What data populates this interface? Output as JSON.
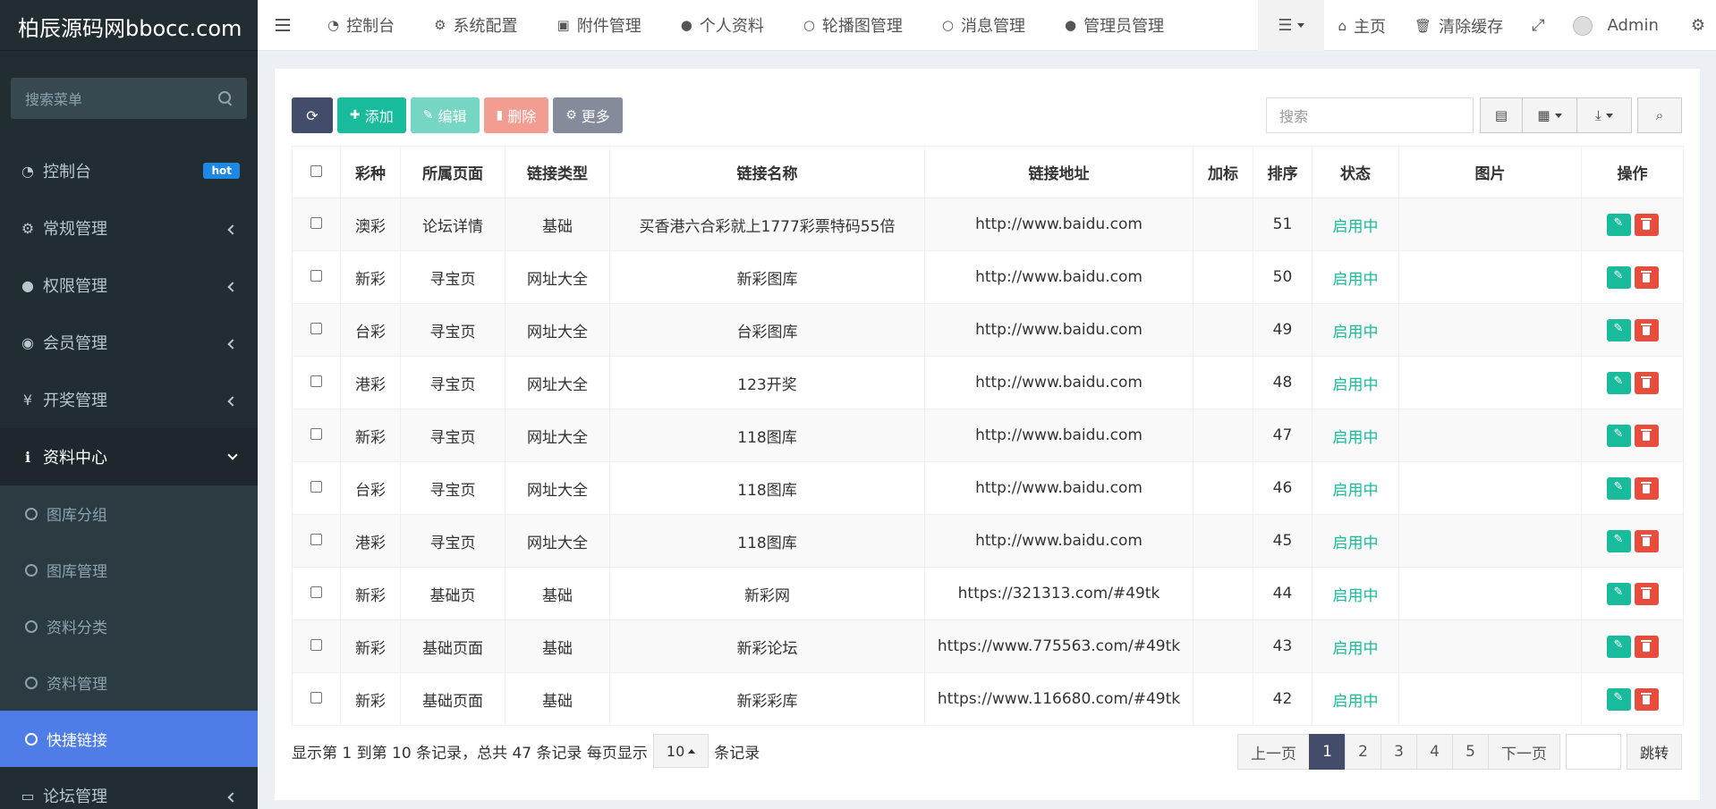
{
  "brand": "柏辰源码网bbocc.com",
  "sidebar": {
    "search_placeholder": "搜索菜单",
    "items": [
      {
        "label": "控制台",
        "icon": "dashboard-icon",
        "badge": "hot"
      },
      {
        "label": "常规管理",
        "icon": "cogs-icon"
      },
      {
        "label": "权限管理",
        "icon": "users-icon"
      },
      {
        "label": "会员管理",
        "icon": "user-circle-icon"
      },
      {
        "label": "开奖管理",
        "icon": "yen-icon"
      },
      {
        "label": "资料中心",
        "icon": "info-icon"
      },
      {
        "label": "论坛管理",
        "icon": "laptop-icon"
      }
    ],
    "submenu": [
      "图库分组",
      "图库管理",
      "资料分类",
      "资料管理",
      "快捷链接"
    ]
  },
  "topnav": {
    "links": [
      "控制台",
      "系统配置",
      "附件管理",
      "个人资料",
      "轮播图管理",
      "消息管理",
      "管理员管理"
    ],
    "home": "主页",
    "clear_cache": "清除缓存",
    "user": "Admin"
  },
  "toolbar": {
    "add": "添加",
    "edit": "编辑",
    "delete": "删除",
    "more": "更多",
    "search_placeholder": "搜索"
  },
  "table": {
    "headers": [
      "彩种",
      "所属页面",
      "链接类型",
      "链接名称",
      "链接地址",
      "加标",
      "排序",
      "状态",
      "图片",
      "操作"
    ],
    "rows": [
      {
        "c1": "澳彩",
        "c2": "论坛详情",
        "c3": "基础",
        "c4": "买香港六合彩就上1777彩票特码55倍",
        "c5": "http://www.baidu.com",
        "c6": "",
        "c7": "51",
        "c8": "启用中"
      },
      {
        "c1": "新彩",
        "c2": "寻宝页",
        "c3": "网址大全",
        "c4": "新彩图库",
        "c5": "http://www.baidu.com",
        "c6": "",
        "c7": "50",
        "c8": "启用中"
      },
      {
        "c1": "台彩",
        "c2": "寻宝页",
        "c3": "网址大全",
        "c4": "台彩图库",
        "c5": "http://www.baidu.com",
        "c6": "",
        "c7": "49",
        "c8": "启用中"
      },
      {
        "c1": "港彩",
        "c2": "寻宝页",
        "c3": "网址大全",
        "c4": "123开奖",
        "c5": "http://www.baidu.com",
        "c6": "",
        "c7": "48",
        "c8": "启用中"
      },
      {
        "c1": "新彩",
        "c2": "寻宝页",
        "c3": "网址大全",
        "c4": "118图库",
        "c5": "http://www.baidu.com",
        "c6": "",
        "c7": "47",
        "c8": "启用中"
      },
      {
        "c1": "台彩",
        "c2": "寻宝页",
        "c3": "网址大全",
        "c4": "118图库",
        "c5": "http://www.baidu.com",
        "c6": "",
        "c7": "46",
        "c8": "启用中"
      },
      {
        "c1": "港彩",
        "c2": "寻宝页",
        "c3": "网址大全",
        "c4": "118图库",
        "c5": "http://www.baidu.com",
        "c6": "",
        "c7": "45",
        "c8": "启用中"
      },
      {
        "c1": "新彩",
        "c2": "基础页",
        "c3": "基础",
        "c4": "新彩网",
        "c5": "https://321313.com/#49tk",
        "c6": "",
        "c7": "44",
        "c8": "启用中"
      },
      {
        "c1": "新彩",
        "c2": "基础页面",
        "c3": "基础",
        "c4": "新彩论坛",
        "c5": "https://www.775563.com/#49tk",
        "c6": "",
        "c7": "43",
        "c8": "启用中"
      },
      {
        "c1": "新彩",
        "c2": "基础页面",
        "c3": "基础",
        "c4": "新彩彩库",
        "c5": "https://www.116680.com/#49tk",
        "c6": "",
        "c7": "42",
        "c8": "启用中"
      }
    ]
  },
  "footer": {
    "info_prefix": "显示第 1 到第 10 条记录，总共 47 条记录 每页显示",
    "page_size": "10",
    "info_suffix": "条记录",
    "prev": "上一页",
    "pages": [
      "1",
      "2",
      "3",
      "4",
      "5"
    ],
    "next": "下一页",
    "go": "跳转"
  }
}
